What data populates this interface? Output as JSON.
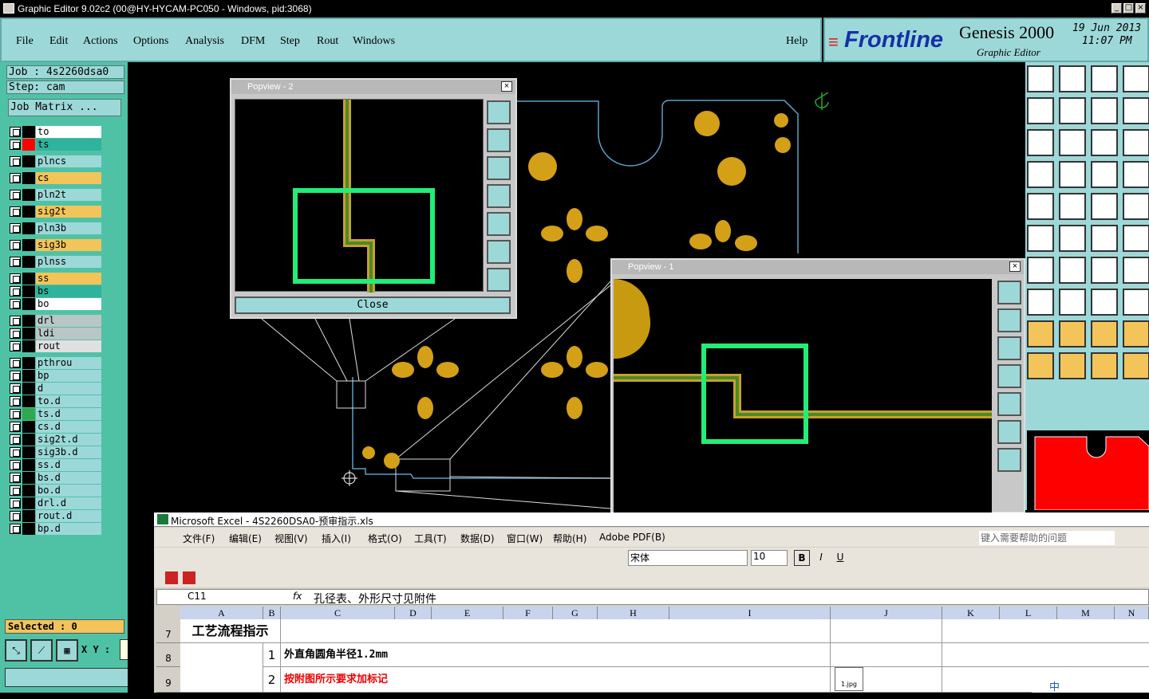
{
  "window": {
    "title": "Graphic Editor 9.02c2 (00@HY-HYCAM-PC050 - Windows, pid:3068)"
  },
  "menu": {
    "items": [
      "File",
      "Edit",
      "Actions",
      "Options",
      "Analysis",
      "DFM",
      "Step",
      "Rout",
      "Windows"
    ],
    "help": "Help"
  },
  "brand": {
    "logo": "Frontline",
    "product": "Genesis 2000",
    "subtitle": "Graphic Editor",
    "date": "19 Jun 2013",
    "time": "11:07 PM"
  },
  "job": {
    "job_label": "Job : 4s2260dsa0",
    "step_label": "Step: cam",
    "matrix_button": "Job Matrix ..."
  },
  "layers": [
    {
      "name": "to",
      "bg": "#ffffff",
      "sw": "#000000"
    },
    {
      "name": "ts",
      "bg": "#2fb39c",
      "sw": "#ff0000",
      "sel": true
    },
    {
      "name": "plncs",
      "bg": "#9dd8d8",
      "sw": "#000000"
    },
    {
      "name": "cs",
      "bg": "#f2c45a",
      "sw": "#000000"
    },
    {
      "name": "pln2t",
      "bg": "#9dd8d8",
      "sw": "#000000"
    },
    {
      "name": "sig2t",
      "bg": "#f2c45a",
      "sw": "#000000"
    },
    {
      "name": "pln3b",
      "bg": "#9dd8d8",
      "sw": "#000000"
    },
    {
      "name": "sig3b",
      "bg": "#f2c45a",
      "sw": "#000000"
    },
    {
      "name": "plnss",
      "bg": "#9dd8d8",
      "sw": "#000000"
    },
    {
      "name": "ss",
      "bg": "#f2c45a",
      "sw": "#000000"
    },
    {
      "name": "bs",
      "bg": "#2fb39c",
      "sw": "#000000"
    },
    {
      "name": "bo",
      "bg": "#ffffff",
      "sw": "#000000"
    },
    {
      "name": "drl",
      "bg": "#b9c6c6",
      "sw": "#000000"
    },
    {
      "name": "ldi",
      "bg": "#b9c6c6",
      "sw": "#000000"
    },
    {
      "name": "rout",
      "bg": "#e0e0e0",
      "sw": "#000000"
    },
    {
      "name": "pthrou",
      "bg": "#9dd8d8",
      "sw": "#000000"
    },
    {
      "name": "bp",
      "bg": "#9dd8d8",
      "sw": "#000000"
    },
    {
      "name": "d",
      "bg": "#9dd8d8",
      "sw": "#000000"
    },
    {
      "name": "to.d",
      "bg": "#9dd8d8",
      "sw": "#000000"
    },
    {
      "name": "ts.d",
      "bg": "#9dd8d8",
      "sw": "#2fa84f"
    },
    {
      "name": "cs.d",
      "bg": "#9dd8d8",
      "sw": "#000000"
    },
    {
      "name": "sig2t.d",
      "bg": "#9dd8d8",
      "sw": "#000000"
    },
    {
      "name": "sig3b.d",
      "bg": "#9dd8d8",
      "sw": "#000000"
    },
    {
      "name": "ss.d",
      "bg": "#9dd8d8",
      "sw": "#000000"
    },
    {
      "name": "bs.d",
      "bg": "#9dd8d8",
      "sw": "#000000"
    },
    {
      "name": "bo.d",
      "bg": "#9dd8d8",
      "sw": "#000000"
    },
    {
      "name": "drl.d",
      "bg": "#9dd8d8",
      "sw": "#000000"
    },
    {
      "name": "rout.d",
      "bg": "#9dd8d8",
      "sw": "#000000"
    },
    {
      "name": "bp.d",
      "bg": "#9dd8d8",
      "sw": "#000000"
    }
  ],
  "status": {
    "selected": "Selected : 0",
    "xy_label": "X Y :"
  },
  "popview2": {
    "title": "Popview - 2",
    "close": "Close"
  },
  "popview1": {
    "title": "Popview - 1"
  },
  "excel": {
    "title": "Microsoft Excel - 4S2260DSA0-预审指示.xls",
    "menu": [
      "文件(F)",
      "编辑(E)",
      "视图(V)",
      "插入(I)",
      "格式(O)",
      "工具(T)",
      "数据(D)",
      "窗口(W)",
      "帮助(H)",
      "Adobe PDF(B)"
    ],
    "help_placeholder": "键入需要帮助的问题",
    "font": "宋体",
    "font_size": "10",
    "cell_ref": "C11",
    "fx": "fx",
    "formula": "孔径表、外形尺寸见附件",
    "columns": [
      "A",
      "B",
      "C",
      "D",
      "E",
      "F",
      "G",
      "H",
      "I",
      "J",
      "K",
      "L",
      "M",
      "N"
    ],
    "rows": [
      {
        "num": "7",
        "a": "工艺流程指示",
        "b": "",
        "c": ""
      },
      {
        "num": "8",
        "a": "",
        "b": "1",
        "c": "外直角圆角半径1.2mm"
      },
      {
        "num": "9",
        "a": "",
        "b": "2",
        "c": "按附图所示要求加标记"
      }
    ],
    "attachment": "1.jpg",
    "ime": "中"
  },
  "colors": {
    "accent": "#9dd8d8",
    "panel": "#4fc2a6",
    "pad": "#d4a017",
    "highlight": "#22ee77"
  }
}
